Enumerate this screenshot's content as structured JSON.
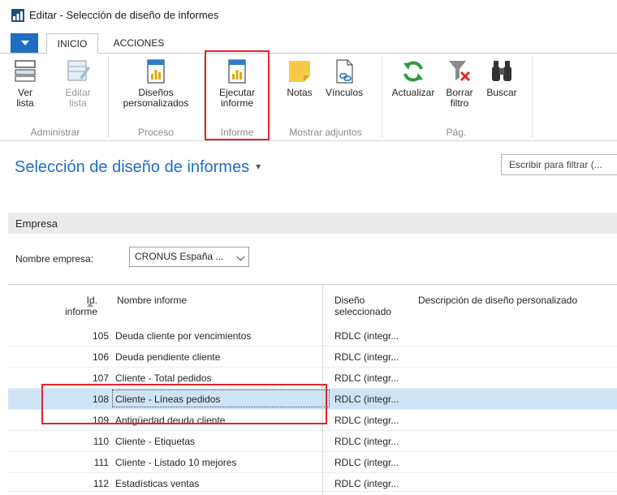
{
  "window": {
    "title": "Editar - Selección de diseño de informes"
  },
  "tabs": [
    {
      "label": "INICIO",
      "active": true
    },
    {
      "label": "ACCIONES",
      "active": false
    }
  ],
  "ribbon": {
    "groups": [
      {
        "label": "Administrar",
        "items": [
          {
            "label1": "Ver",
            "label2": "lista",
            "icon": "list-view-icon",
            "enabled": true
          },
          {
            "label1": "Editar",
            "label2": "lista",
            "icon": "edit-list-icon",
            "enabled": false
          }
        ]
      },
      {
        "label": "Proceso",
        "items": [
          {
            "label1": "Diseños",
            "label2": "personalizados",
            "icon": "report-icon",
            "enabled": true
          }
        ]
      },
      {
        "label": "Informe",
        "items": [
          {
            "label1": "Ejecutar",
            "label2": "informe",
            "icon": "report-icon",
            "enabled": true
          }
        ]
      },
      {
        "label": "Mostrar adjuntos",
        "items": [
          {
            "label1": "Notas",
            "label2": "",
            "icon": "note-icon",
            "enabled": true
          },
          {
            "label1": "Vínculos",
            "label2": "",
            "icon": "link-icon",
            "enabled": true
          }
        ]
      },
      {
        "label": "Pág.",
        "items": [
          {
            "label1": "Actualizar",
            "label2": "",
            "icon": "refresh-icon",
            "enabled": true
          },
          {
            "label1": "Borrar",
            "label2": "filtro",
            "icon": "clear-filter-icon",
            "enabled": true
          },
          {
            "label1": "Buscar",
            "label2": "",
            "icon": "binoculars-icon",
            "enabled": true
          }
        ]
      }
    ]
  },
  "page": {
    "title": "Selección de diseño de informes",
    "title_caret": "▾",
    "filter_placeholder": "Escribir para filtrar (..."
  },
  "fasttab": {
    "label": "Empresa"
  },
  "company": {
    "label": "Nombre empresa:",
    "value": "CRONUS España ..."
  },
  "grid": {
    "headers": {
      "id_line1": "Id.",
      "id_line2": "informe",
      "name": "Nombre informe",
      "layout_line1": "Diseño",
      "layout_line2": "seleccionado",
      "desc": "Descripción de diseño personalizado"
    },
    "rows": [
      {
        "id": "105",
        "name": "Deuda cliente por vencimientos",
        "layout": "RDLC (integr...",
        "selected": false
      },
      {
        "id": "106",
        "name": "Deuda pendiente cliente",
        "layout": "RDLC (integr...",
        "selected": false
      },
      {
        "id": "107",
        "name": "Cliente - Total pedidos",
        "layout": "RDLC (integr...",
        "selected": false
      },
      {
        "id": "108",
        "name": "Cliente - Líneas pedidos",
        "layout": "RDLC (integr...",
        "selected": true
      },
      {
        "id": "109",
        "name": "Antigüedad deuda cliente",
        "layout": "RDLC (integr...",
        "selected": false
      },
      {
        "id": "110",
        "name": "Cliente - Etiquetas",
        "layout": "RDLC (integr...",
        "selected": false
      },
      {
        "id": "111",
        "name": "Cliente - Listado 10 mejores",
        "layout": "RDLC (integr...",
        "selected": false
      },
      {
        "id": "112",
        "name": "Estadísticas ventas",
        "layout": "RDLC (integr...",
        "selected": false
      }
    ]
  },
  "colors": {
    "accent": "#1d6fc4",
    "selection": "#cde4f7",
    "highlight": "#e0262d"
  }
}
